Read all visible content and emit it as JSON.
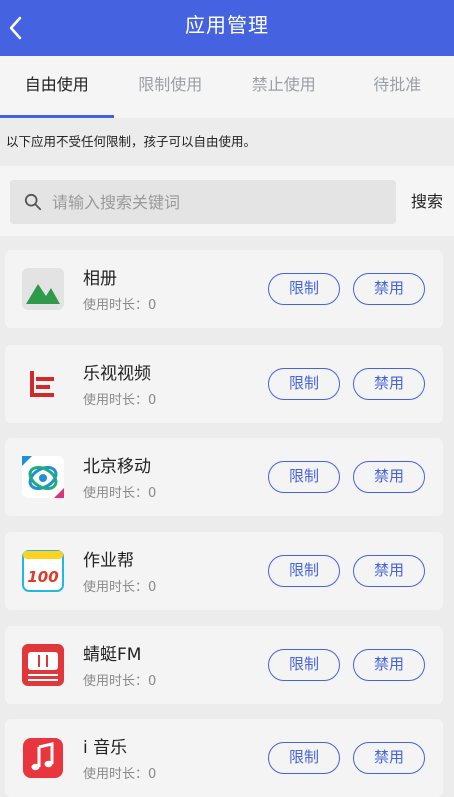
{
  "header": {
    "title": "应用管理"
  },
  "tabs": [
    {
      "label": "自由使用",
      "active": true
    },
    {
      "label": "限制使用",
      "active": false
    },
    {
      "label": "禁止使用",
      "active": false
    },
    {
      "label": "待批准",
      "active": false
    }
  ],
  "notice": "以下应用不受任何限制，孩子可以自由使用。",
  "search": {
    "placeholder": "请输入搜索关键词",
    "button": "搜索"
  },
  "actions": {
    "limit": "限制",
    "ban": "禁用"
  },
  "apps": [
    {
      "name": "相册",
      "usage": "使用时长：0",
      "icon": "photo-album-icon"
    },
    {
      "name": "乐视视频",
      "usage": "使用时长：0",
      "icon": "letv-video-icon"
    },
    {
      "name": "北京移动",
      "usage": "使用时长：0",
      "icon": "china-mobile-icon"
    },
    {
      "name": "作业帮",
      "usage": "使用时长：0",
      "icon": "zuoyebang-icon"
    },
    {
      "name": "蜻蜓FM",
      "usage": "使用时长：0",
      "icon": "qingting-fm-icon"
    },
    {
      "name": "i 音乐",
      "usage": "使用时长：0",
      "icon": "i-music-icon"
    }
  ],
  "colors": {
    "primary": "#4563e0",
    "background": "#ececec"
  }
}
